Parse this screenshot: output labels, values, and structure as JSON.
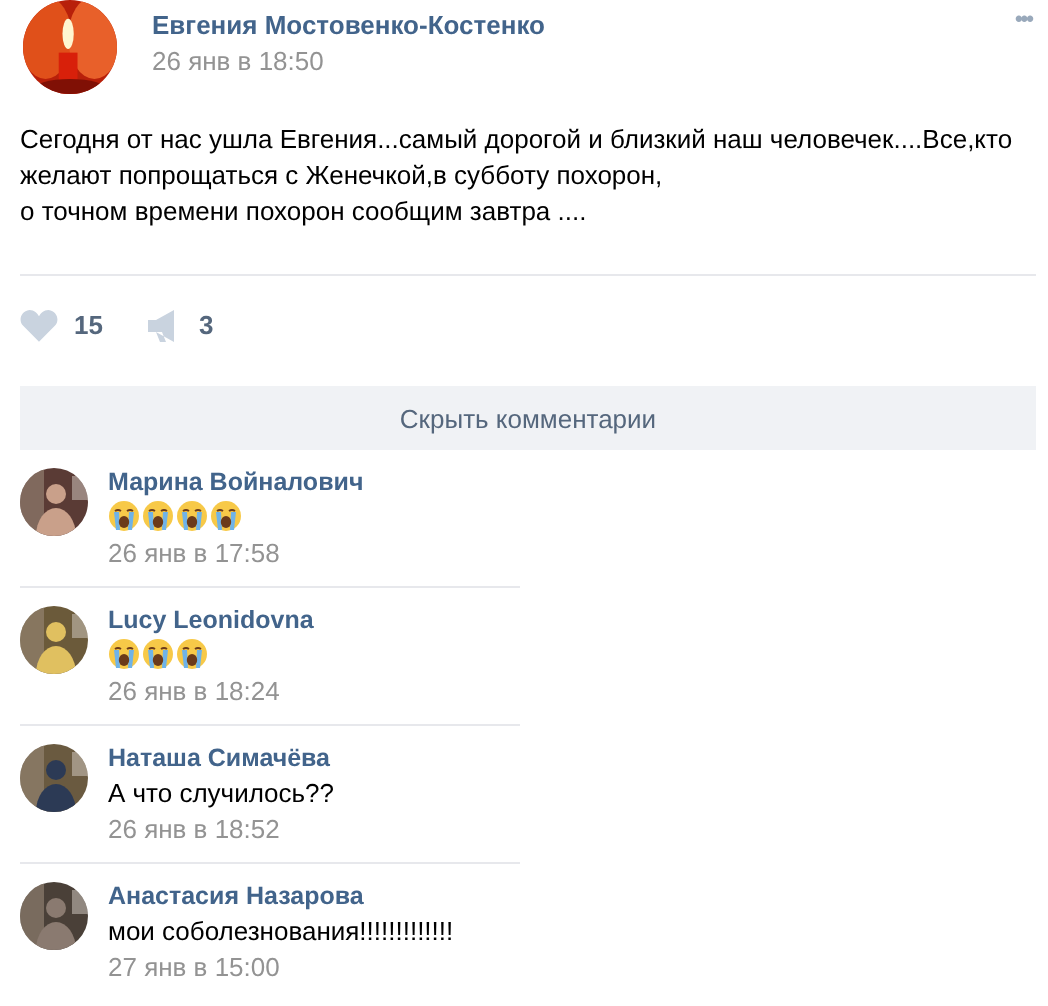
{
  "post": {
    "author": "Евгения Мостовенко-Костенко",
    "date": "26 янв в 18:50",
    "more": "•••",
    "text": [
      "Сегодня от нас ушла Евгения...самый дорогой и близкий наш человечек....Все,кто желают попрощаться с Женечкой,в субботу похорон,",
      "о точном времени похорон сообщим завтра ...."
    ],
    "likes": "15",
    "shares": "3"
  },
  "hide_comments": "Скрыть комментарии",
  "comments": [
    {
      "author": "Марина Войналович",
      "emojis": [
        {
          "kind": "crying"
        },
        {
          "kind": "crying"
        },
        {
          "kind": "crying"
        },
        {
          "kind": "crying"
        }
      ],
      "date": "26 янв в 17:58"
    },
    {
      "author": "Lucy Leonidovna",
      "emojis": [
        {
          "kind": "crying"
        },
        {
          "kind": "crying"
        },
        {
          "kind": "crying"
        }
      ],
      "date": "26 янв в 18:24"
    },
    {
      "author": "Наташа Симачёва",
      "text": "А что случилось??",
      "date": "26 янв в 18:52"
    },
    {
      "author": "Анастасия Назарова",
      "text": "мои соболезнования!!!!!!!!!!!!!",
      "date": "27 янв в 15:00"
    }
  ]
}
